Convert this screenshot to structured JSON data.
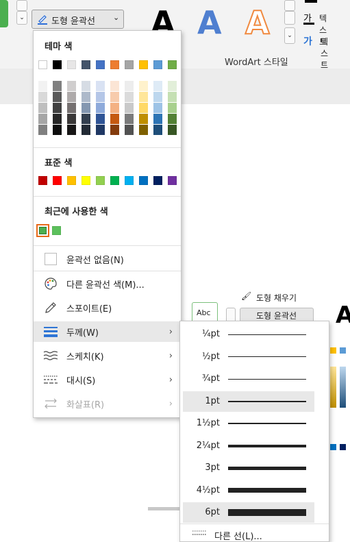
{
  "ribbon": {
    "shape_outline_label": "도형 윤곽선",
    "wordart_letter": "A",
    "wordart_group_label": "WordArt 스타일",
    "text_fill_label": "텍스트",
    "text_outline_label": "텍스트",
    "shape_fill_label": "도형 채우기",
    "shape_outline_label_2": "도형 윤곽선",
    "abc_label": "Abc"
  },
  "menu": {
    "theme_colors_title": "테마 색",
    "theme_colors": [
      "#ffffff",
      "#000000",
      "#e7e6e6",
      "#44546a",
      "#4472c4",
      "#ed7d31",
      "#a5a5a5",
      "#ffc000",
      "#5b9bd5",
      "#70ad47"
    ],
    "theme_shades": [
      [
        "#f2f2f2",
        "#d9d9d9",
        "#bfbfbf",
        "#a6a6a6",
        "#808080"
      ],
      [
        "#808080",
        "#595959",
        "#404040",
        "#262626",
        "#0d0d0d"
      ],
      [
        "#d0cece",
        "#aeaaaa",
        "#757070",
        "#3a3838",
        "#171616"
      ],
      [
        "#d6dce4",
        "#adb9ca",
        "#8497b0",
        "#333f4f",
        "#222a35"
      ],
      [
        "#d9e2f3",
        "#b4c6e7",
        "#8eaadb",
        "#2f5496",
        "#1f3864"
      ],
      [
        "#fbe5d5",
        "#f7cbac",
        "#f4b183",
        "#c55a11",
        "#843c0c"
      ],
      [
        "#ededed",
        "#dbdbdb",
        "#c9c9c9",
        "#7b7b7b",
        "#525252"
      ],
      [
        "#fff2cc",
        "#ffe699",
        "#ffd966",
        "#bf8f00",
        "#7f6000"
      ],
      [
        "#deebf6",
        "#bdd7ee",
        "#9dc3e6",
        "#2e75b5",
        "#1e4e79"
      ],
      [
        "#e2efd9",
        "#c5e0b3",
        "#a8d08d",
        "#538135",
        "#375623"
      ]
    ],
    "standard_colors_title": "표준 색",
    "standard_colors": [
      "#c00000",
      "#ff0000",
      "#ffc000",
      "#ffff00",
      "#92d050",
      "#00b050",
      "#00b0f0",
      "#0070c0",
      "#002060",
      "#7030a0"
    ],
    "recent_colors_title": "최근에 사용한 색",
    "recent_colors": [
      "#4caf50",
      "#5cc05c"
    ],
    "no_outline": "윤곽선 없음(N)",
    "more_colors": "다른 윤곽선 색(M)...",
    "eyedropper": "스포이트(E)",
    "weight": "두께(W)",
    "sketch": "스케치(K)",
    "dashes": "대시(S)",
    "arrows": "화살표(R)"
  },
  "weight_menu": {
    "options": [
      {
        "label": "¼pt",
        "pt": 0.25
      },
      {
        "label": "½pt",
        "pt": 0.5
      },
      {
        "label": "¾pt",
        "pt": 0.75
      },
      {
        "label": "1pt",
        "pt": 1,
        "selected": true
      },
      {
        "label": "1½pt",
        "pt": 1.5
      },
      {
        "label": "2¼pt",
        "pt": 2.25
      },
      {
        "label": "3pt",
        "pt": 3
      },
      {
        "label": "4½pt",
        "pt": 4.5
      },
      {
        "label": "6pt",
        "pt": 6,
        "selected": true
      }
    ],
    "more_lines": "다른 선(L)..."
  }
}
